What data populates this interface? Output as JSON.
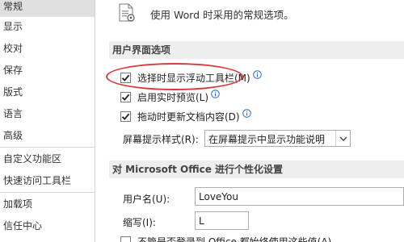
{
  "sidebar": {
    "items": [
      {
        "label": "常规",
        "selected": true
      },
      {
        "label": "显示"
      },
      {
        "label": "校对"
      },
      {
        "label": "保存"
      },
      {
        "label": "版式"
      },
      {
        "label": "语言"
      },
      {
        "label": "高级"
      },
      {
        "label": "自定义功能区"
      },
      {
        "label": "快速访问工具栏"
      },
      {
        "label": "加载项"
      },
      {
        "label": "信任中心"
      }
    ]
  },
  "main": {
    "intro_text": "使用 Word 时采用的常规选项。",
    "ui_section": {
      "title": "用户界面选项",
      "options": [
        {
          "label": "选择时显示浮动工具栏(M)",
          "checked": true,
          "has_info": true
        },
        {
          "label": "启用实时预览(L)",
          "checked": true,
          "has_info": true
        },
        {
          "label": "拖动时更新文档内容(D)",
          "checked": true,
          "has_info": true
        }
      ],
      "screentip_label": "屏幕提示样式(R):",
      "screentip_value": "在屏幕提示中显示功能说明"
    },
    "personalize_section": {
      "title": "对 Microsoft Office 进行个性化设置",
      "username_label": "用户名(U):",
      "username_value": "LoveYou",
      "initials_label": "缩写(I):",
      "initials_value": "L",
      "cut_off_text": "不管是否登录到 Office 都始终使用这些值(A)"
    }
  },
  "colors": {
    "highlight": "#d83a3a",
    "selected_nav": "#e0e0e0",
    "section_header_bg": "#eeeeee",
    "info_icon": "#2b6cc4"
  },
  "icons": [
    "options-doc-icon",
    "check-icon",
    "info-icon",
    "chevron-down-icon"
  ]
}
